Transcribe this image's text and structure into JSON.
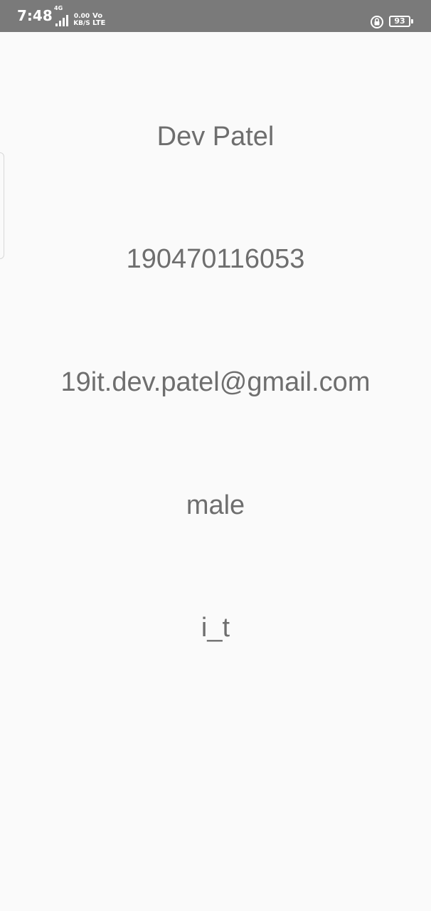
{
  "status_bar": {
    "time": "7:48",
    "network_type": "4G",
    "data_speed_value": "0.00",
    "data_speed_unit": "KB/S",
    "volte_top": "Vo",
    "volte_bottom": "LTE",
    "battery_level": "93",
    "icons": [
      "signal-icon",
      "lock-rotation-icon",
      "battery-icon"
    ]
  },
  "profile": {
    "name": "Dev Patel",
    "enrollment_number": "190470116053",
    "email": "19it.dev.patel@gmail.com",
    "gender": "male",
    "department": "i_t"
  },
  "colors": {
    "status_bar_bg": "#7a7a7a",
    "page_bg": "#fafafa",
    "text": "#6e6e6e"
  }
}
